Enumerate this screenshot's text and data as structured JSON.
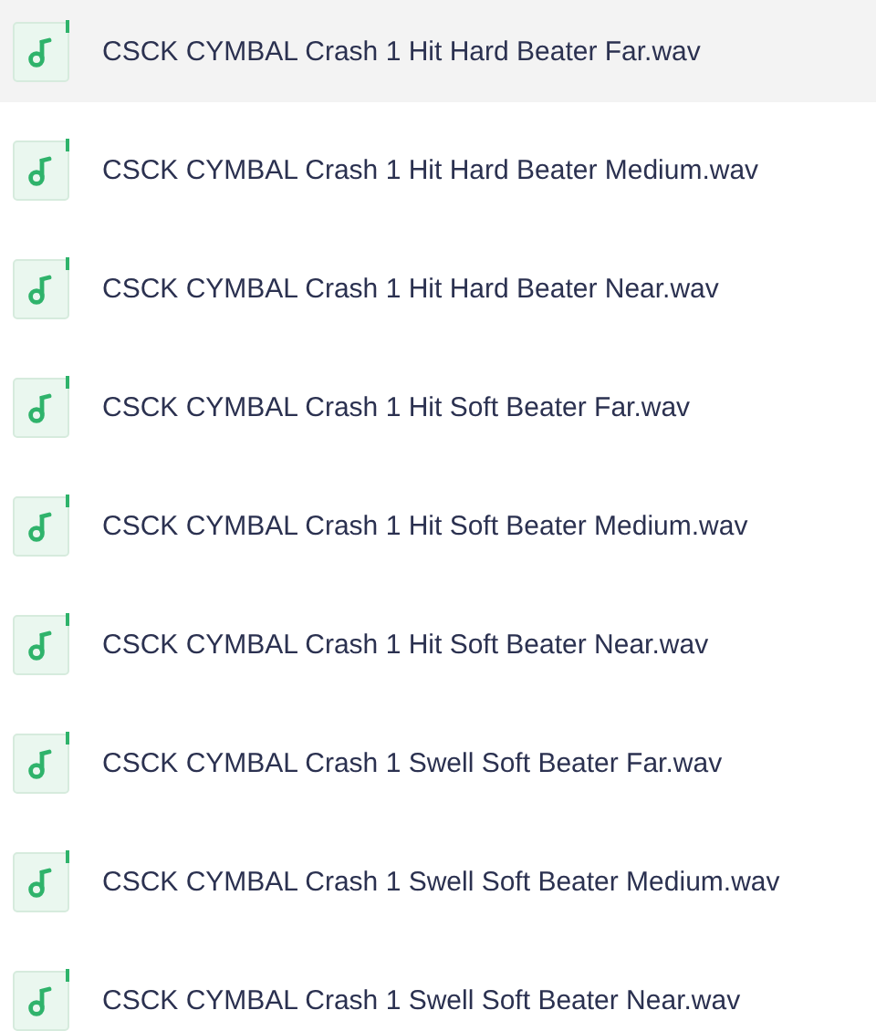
{
  "files": [
    {
      "name": "CSCK CYMBAL Crash 1 Hit Hard Beater Far.wav",
      "selected": true
    },
    {
      "name": "CSCK CYMBAL Crash 1 Hit Hard Beater Medium.wav",
      "selected": false
    },
    {
      "name": "CSCK CYMBAL Crash 1 Hit Hard Beater Near.wav",
      "selected": false
    },
    {
      "name": "CSCK CYMBAL Crash 1 Hit Soft Beater Far.wav",
      "selected": false
    },
    {
      "name": "CSCK CYMBAL Crash 1 Hit Soft Beater Medium.wav",
      "selected": false
    },
    {
      "name": "CSCK CYMBAL Crash 1 Hit Soft Beater Near.wav",
      "selected": false
    },
    {
      "name": "CSCK CYMBAL Crash 1 Swell Soft Beater Far.wav",
      "selected": false
    },
    {
      "name": "CSCK CYMBAL Crash 1 Swell Soft Beater Medium.wav",
      "selected": false
    },
    {
      "name": "CSCK CYMBAL Crash 1 Swell Soft Beater Near.wav",
      "selected": false
    }
  ]
}
